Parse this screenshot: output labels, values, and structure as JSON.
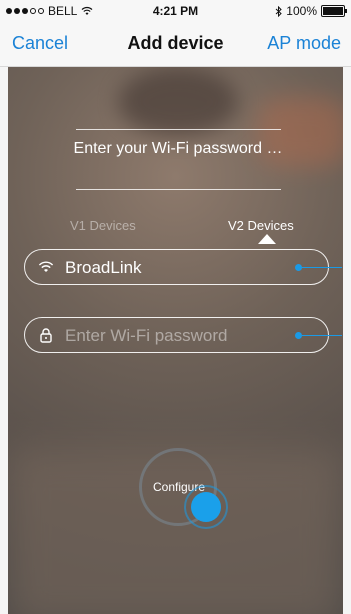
{
  "status_bar": {
    "carrier": "BELL",
    "time": "4:21 PM",
    "battery": "100%",
    "icons": [
      "signal-dots-icon",
      "wifi-icon",
      "bluetooth-icon",
      "battery-icon"
    ]
  },
  "nav": {
    "cancel_label": "Cancel",
    "title": "Add device",
    "ap_mode_label": "AP mode"
  },
  "prompt": {
    "text": "Enter your Wi-Fi password …"
  },
  "tabs": {
    "v1_label": "V1 Devices",
    "v2_label": "V2 Devices",
    "selected": "V2 Devices"
  },
  "ssid_field": {
    "value": "BroadLink",
    "icon": "wifi-icon"
  },
  "password_field": {
    "placeholder": "Enter Wi-Fi password",
    "icon": "lock-icon"
  },
  "configure": {
    "label": "Configure"
  },
  "colors": {
    "accent": "#1a82d6",
    "knob": "#1aa0ea"
  }
}
